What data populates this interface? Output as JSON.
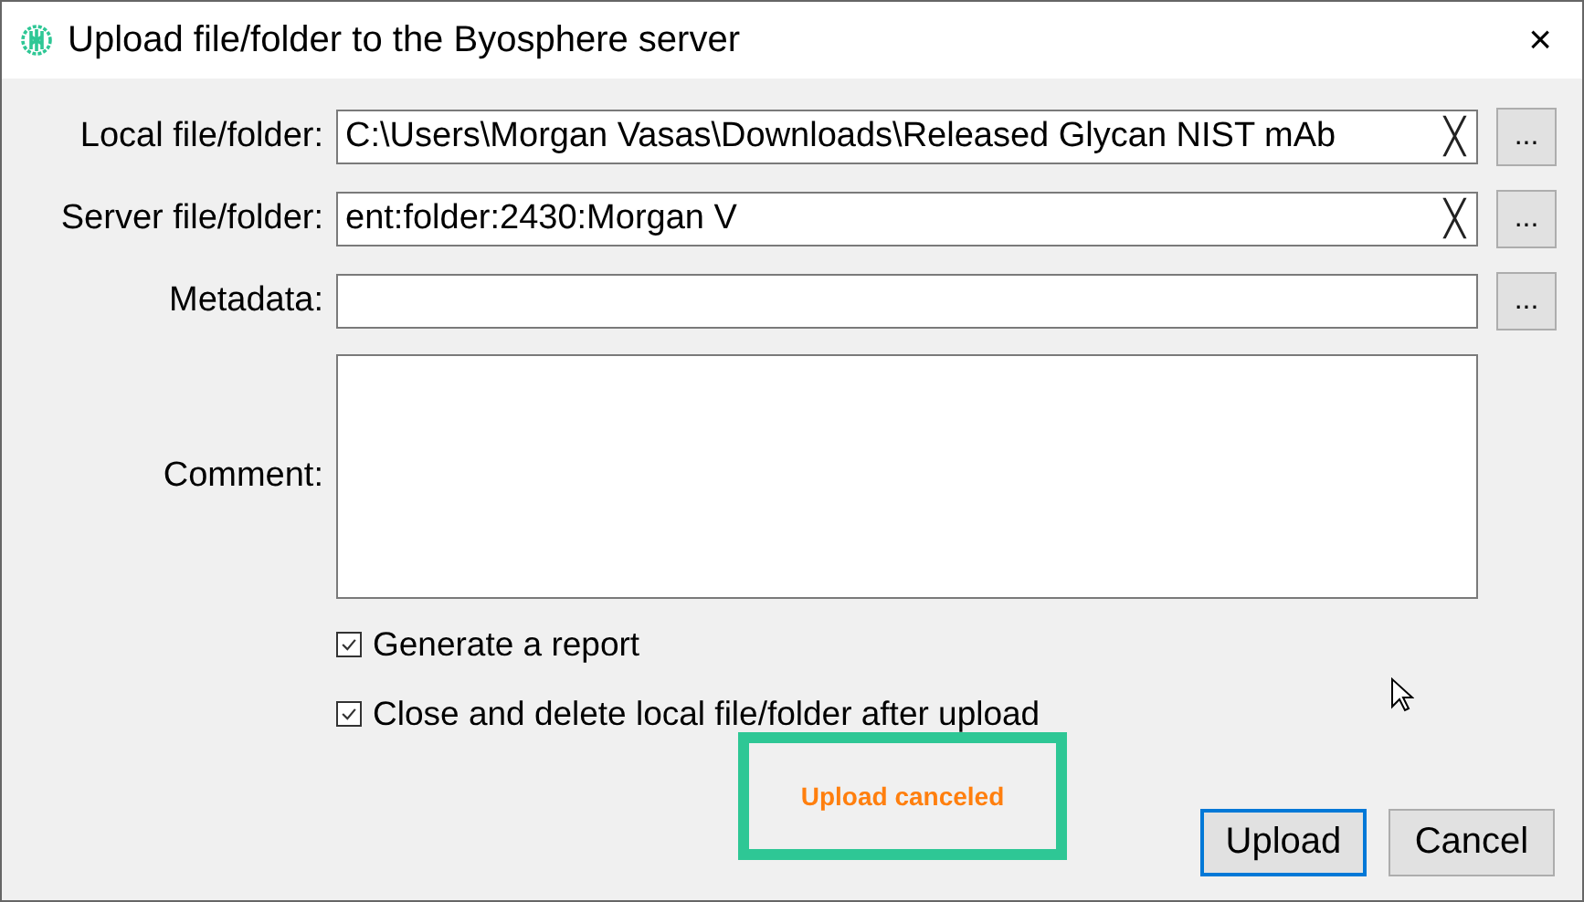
{
  "window": {
    "title": "Upload file/folder to the Byosphere server",
    "close": "×"
  },
  "fields": [
    {
      "kind": "path",
      "label": "Local file/folder:",
      "value": "C:\\Users\\Morgan Vasas\\Downloads\\Released Glycan NIST mAb",
      "clear": "╳",
      "browse": "..."
    },
    {
      "kind": "path",
      "label": "Server file/folder:",
      "value": "ent:folder:2430:Morgan V",
      "clear": "╳",
      "browse": "..."
    },
    {
      "kind": "path",
      "label": "Metadata:",
      "browse": "..."
    },
    {
      "kind": "comment",
      "label": "Comment:"
    }
  ],
  "options": [
    {
      "label": "Generate a report",
      "checked": true
    },
    {
      "label": "Close and delete local file/folder after upload",
      "checked": true
    }
  ],
  "status": {
    "message": "Upload canceled"
  },
  "buttons": [
    {
      "label": "Upload",
      "focused": true
    },
    {
      "label": "Cancel",
      "focused": false
    }
  ]
}
